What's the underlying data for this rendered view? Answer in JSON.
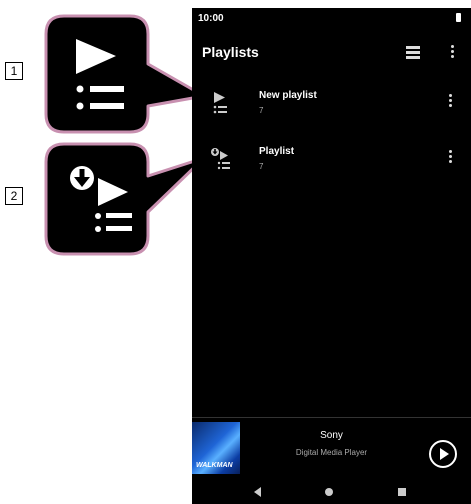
{
  "status_bar": {
    "time": "10:00"
  },
  "app_bar": {
    "title": "Playlists"
  },
  "playlists": [
    {
      "name": "New playlist",
      "count": "7",
      "icon": "playlist-icon"
    },
    {
      "name": "Playlist",
      "count": "7",
      "icon": "downloaded-playlist-icon"
    }
  ],
  "now_playing": {
    "artist": "Sony",
    "album": "Digital Media Player",
    "art_label": "WALKMAN"
  },
  "callouts": [
    {
      "number": "1",
      "icon": "playlist-icon"
    },
    {
      "number": "2",
      "icon": "downloaded-playlist-icon"
    }
  ],
  "colors": {
    "callout_border": "#c890b0",
    "screen_bg": "#000000",
    "callout_bg": "#000000"
  }
}
